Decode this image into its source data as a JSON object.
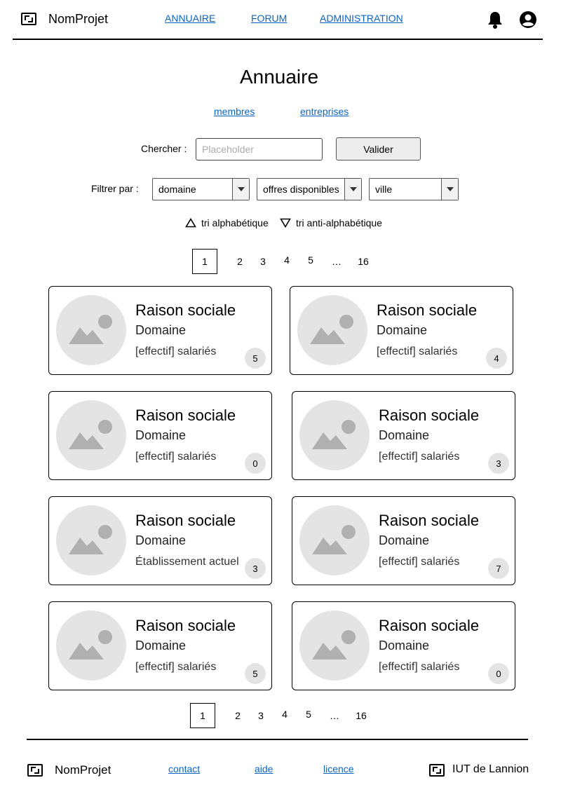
{
  "header": {
    "app_name": "NomProjet",
    "nav": [
      {
        "label": "ANNUAIRE"
      },
      {
        "label": "FORUM"
      },
      {
        "label": "ADMINISTRATION"
      }
    ]
  },
  "page": {
    "title": "Annuaire",
    "tabs": [
      {
        "label": "membres"
      },
      {
        "label": "entreprises"
      }
    ]
  },
  "search": {
    "label": "Chercher :",
    "placeholder": "Placeholder",
    "value": "",
    "submit_label": "Valider"
  },
  "filters": {
    "label": "Filtrer par :",
    "selects": [
      {
        "selected": "domaine"
      },
      {
        "selected": "offres disponibles"
      },
      {
        "selected": "ville"
      }
    ]
  },
  "sort": {
    "asc_label": "tri alphabétique",
    "desc_label": "tri anti-alphabétique"
  },
  "pagination": {
    "current": "1",
    "pages": [
      "1",
      "2",
      "3",
      "4",
      "5",
      "…",
      "16"
    ]
  },
  "cards": [
    {
      "title": "Raison sociale",
      "domaine": "Domaine",
      "info": "[effectif] salariés",
      "count": "5"
    },
    {
      "title": "Raison sociale",
      "domaine": "Domaine",
      "info": "[effectif] salariés",
      "count": "4"
    },
    {
      "title": "Raison sociale",
      "domaine": "Domaine",
      "info": "[effectif] salariés",
      "count": "0"
    },
    {
      "title": "Raison sociale",
      "domaine": "Domaine",
      "info": "[effectif] salariés",
      "count": "3"
    },
    {
      "title": "Raison sociale",
      "domaine": "Domaine",
      "info": "Établissement actuel",
      "count": "3"
    },
    {
      "title": "Raison sociale",
      "domaine": "Domaine",
      "info": "[effectif] salariés",
      "count": "7"
    },
    {
      "title": "Raison sociale",
      "domaine": "Domaine",
      "info": "[effectif] salariés",
      "count": "5"
    },
    {
      "title": "Raison sociale",
      "domaine": "Domaine",
      "info": "[effectif] salariés",
      "count": "0"
    }
  ],
  "footer": {
    "app_name": "NomProjet",
    "links": [
      {
        "label": "contact"
      },
      {
        "label": "aide"
      },
      {
        "label": "licence"
      }
    ],
    "institution": "IUT de Lannion"
  },
  "icons": {
    "logo": "logo-icon",
    "notifications": "bell-icon",
    "account": "user-circle-icon",
    "image_placeholder": "image-placeholder-icon",
    "dropdown": "chevron-down-icon",
    "sort_asc": "triangle-up-icon",
    "sort_desc": "triangle-down-icon"
  }
}
